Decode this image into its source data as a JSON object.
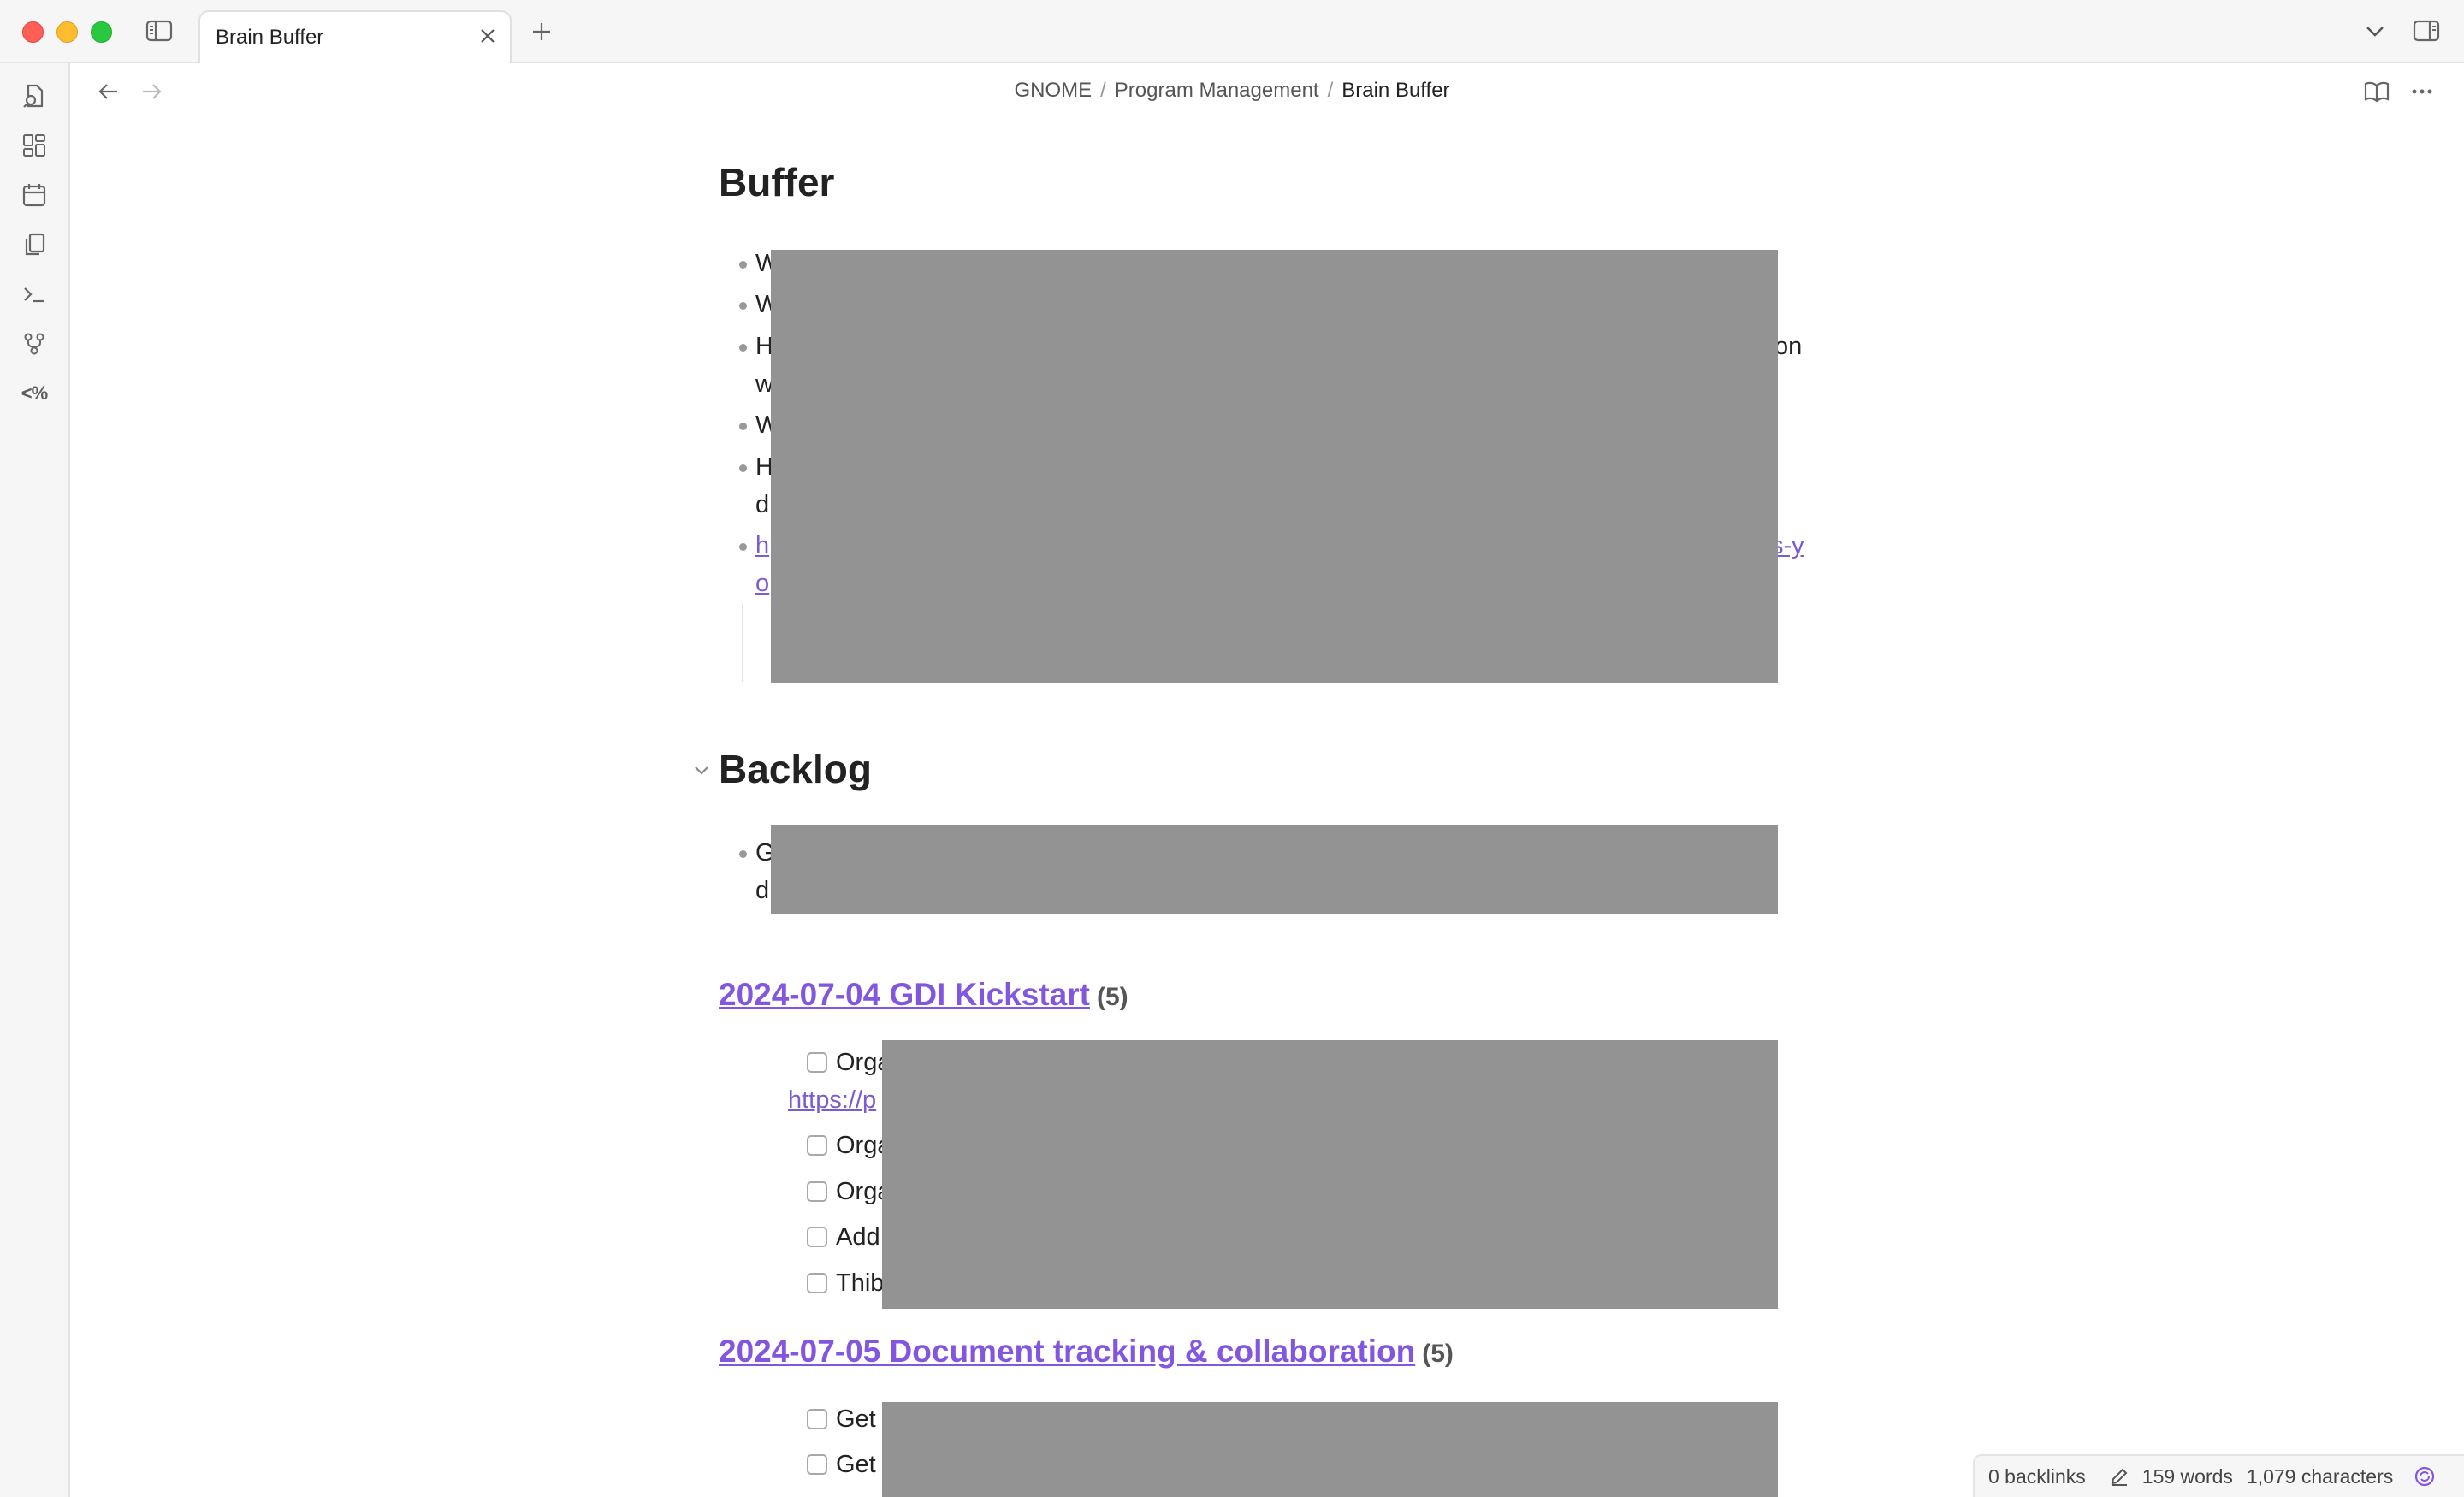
{
  "window": {
    "tab_title": "Brain Buffer",
    "icons": {
      "close": "close-icon",
      "minimize": "minimize-icon",
      "zoom": "zoom-icon",
      "sidebar_toggle": "sidebar-toggle-icon",
      "new_tab": "plus-icon",
      "tab_list": "chevron-down-icon",
      "right_sidebar": "right-sidebar-icon"
    }
  },
  "ribbon": {
    "items": [
      {
        "name": "open-quick-switcher",
        "icon": "file-search-icon"
      },
      {
        "name": "open-canvas",
        "icon": "dashboard-grid-icon"
      },
      {
        "name": "open-daily-note",
        "icon": "calendar-icon"
      },
      {
        "name": "copy",
        "icon": "copy-pages-icon"
      },
      {
        "name": "command-palette",
        "icon": "terminal-icon"
      },
      {
        "name": "graph-view",
        "icon": "git-branch-icon"
      },
      {
        "name": "templater",
        "icon": "templater-icon",
        "text": "<%"
      }
    ]
  },
  "navbar": {
    "breadcrumb": [
      "GNOME",
      "Program Management",
      "Brain Buffer"
    ],
    "icons": {
      "back": "arrow-left-icon",
      "forward": "arrow-right-icon",
      "reading_mode": "book-open-icon",
      "more": "more-horizontal-icon"
    }
  },
  "note": {
    "buffer_heading": "Buffer",
    "buffer_lines": [
      {
        "visible": "W"
      },
      {
        "visible": "W"
      },
      {
        "visible_start": "H",
        "visible_end": "on",
        "second_line": "w"
      },
      {
        "visible": "W"
      },
      {
        "visible_start": "H",
        "second_line": "d"
      },
      {
        "link_start": "h",
        "link_end": "s-y",
        "link_second": "o"
      }
    ],
    "backlog_heading": "Backlog",
    "backlog_lines": [
      {
        "visible": "G",
        "second_line": "d"
      }
    ],
    "sections": [
      {
        "title": "2024-07-04 GDI Kickstart",
        "count": "(5)",
        "tasks": [
          "Orga",
          "Orga",
          "Orga",
          "Add",
          "Thib"
        ],
        "link_fragment": "https://p"
      },
      {
        "title": "2024-07-05 Document tracking & collaboration",
        "count": "(5)",
        "tasks": [
          "Get",
          "Get"
        ]
      }
    ]
  },
  "status": {
    "backlinks": "0 backlinks",
    "words": "159 words",
    "characters": "1,079 characters",
    "icons": {
      "edit": "pencil-icon",
      "sync": "sync-icon"
    }
  },
  "colors": {
    "accent": "#8356e0",
    "redaction": "#939393",
    "chrome": "#f6f6f6"
  }
}
